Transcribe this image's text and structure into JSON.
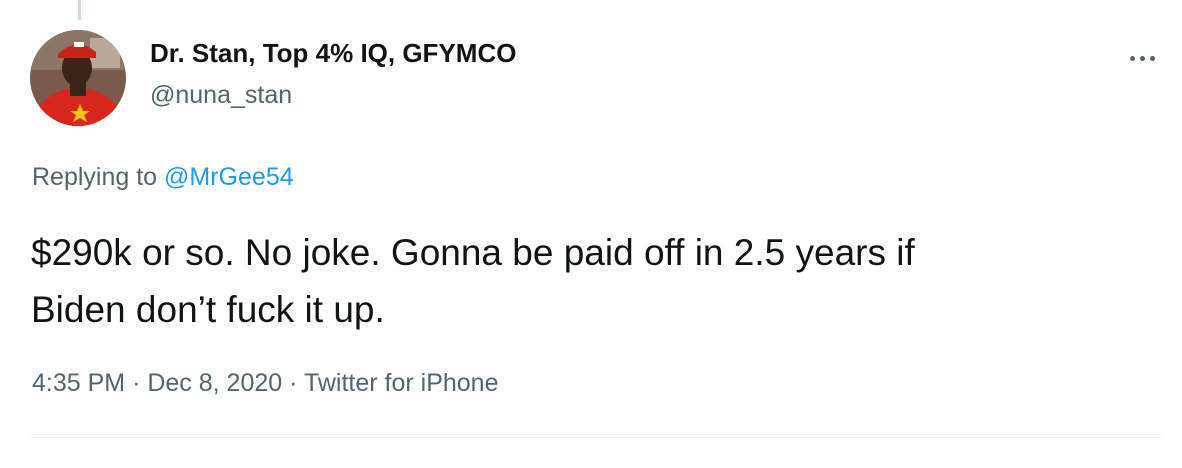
{
  "tweet": {
    "author": {
      "display_name": "Dr. Stan, Top 4% IQ, GFYMCO",
      "handle": "@nuna_stan"
    },
    "replying_prefix": "Replying to",
    "replying_to": "@MrGee54",
    "text_line1": "$290k or so. No joke. Gonna be paid off in 2.5 years if",
    "text_line2": "Biden don’t fuck it up.",
    "time": "4:35 PM",
    "separator": "·",
    "date": "Dec 8, 2020",
    "source": "Twitter for iPhone"
  },
  "icons": {
    "more": "more-horizontal-icon",
    "avatar": "profile-avatar"
  },
  "colors": {
    "text_primary": "#0f1419",
    "text_secondary": "#536471",
    "link": "#1d9bf0",
    "divider": "#eff3f4"
  }
}
